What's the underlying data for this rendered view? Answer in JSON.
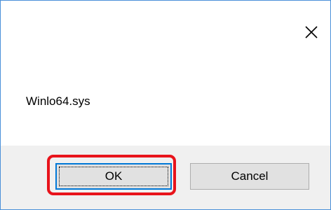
{
  "dialog": {
    "message": "Winlo64.sys",
    "close_symbol": "✕",
    "buttons": {
      "ok_label": "OK",
      "cancel_label": "Cancel"
    }
  },
  "annotation": {
    "highlight_color": "#e8131b",
    "highlight_target": "OK"
  },
  "colors": {
    "dialog_border": "#4a90d9",
    "button_bar_bg": "#f0f0f0",
    "button_bg": "#e1e1e1",
    "default_button_border": "#0078d7"
  }
}
